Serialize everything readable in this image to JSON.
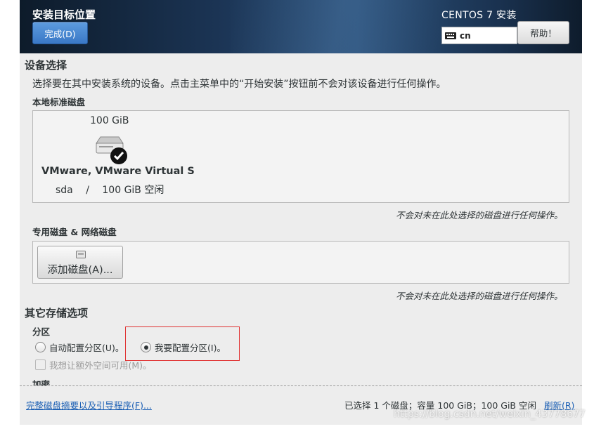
{
  "header": {
    "title": "安装目标位置",
    "done_label": "完成(D)",
    "product": "CENTOS 7 安装",
    "keyboard_layout": "cn",
    "help_label": "帮助！"
  },
  "device_selection": {
    "heading": "设备选择",
    "description": "选择要在其中安装系统的设备。点击主菜单中的“开始安装”按钮前不会对该设备进行任何操作。",
    "local_disks": {
      "heading": "本地标准磁盘",
      "disks": [
        {
          "size": "100 GiB",
          "name": "VMware, VMware Virtual S",
          "device": "sda",
          "separator": "/",
          "free": "100 GiB 空闲",
          "selected": true
        }
      ],
      "note": "不会对未在此处选择的磁盘进行任何操作。"
    },
    "specialized_disks": {
      "heading": "专用磁盘 & 网络磁盘",
      "add_disk_label": "添加磁盘(A)...",
      "note": "不会对未在此处选择的磁盘进行任何操作。"
    }
  },
  "other_storage": {
    "heading": "其它存储选项",
    "partitioning": {
      "heading": "分区",
      "auto_label": "自动配置分区(U)。",
      "manual_label": "我要配置分区(I)。",
      "selected": "manual",
      "extra_space_label": "我想让额外空间可用(M)。"
    },
    "encryption_heading": "加密"
  },
  "footer": {
    "summary_link": "完整磁盘摘要以及引导程序(F)...",
    "status": "已选择 1 个磁盘；容量 100 GiB；100 GiB 空闲",
    "refresh_label": "刷新(R)"
  },
  "watermark": "https://blog.csdn.net/weixin_43778677",
  "colors": {
    "header_dark": "#0d1b2a",
    "header_mid": "#2b5079",
    "primary_button": "#3a78c6",
    "link": "#1b5fb4",
    "highlight_box": "#e03030",
    "panel_bg": "#ededed"
  }
}
